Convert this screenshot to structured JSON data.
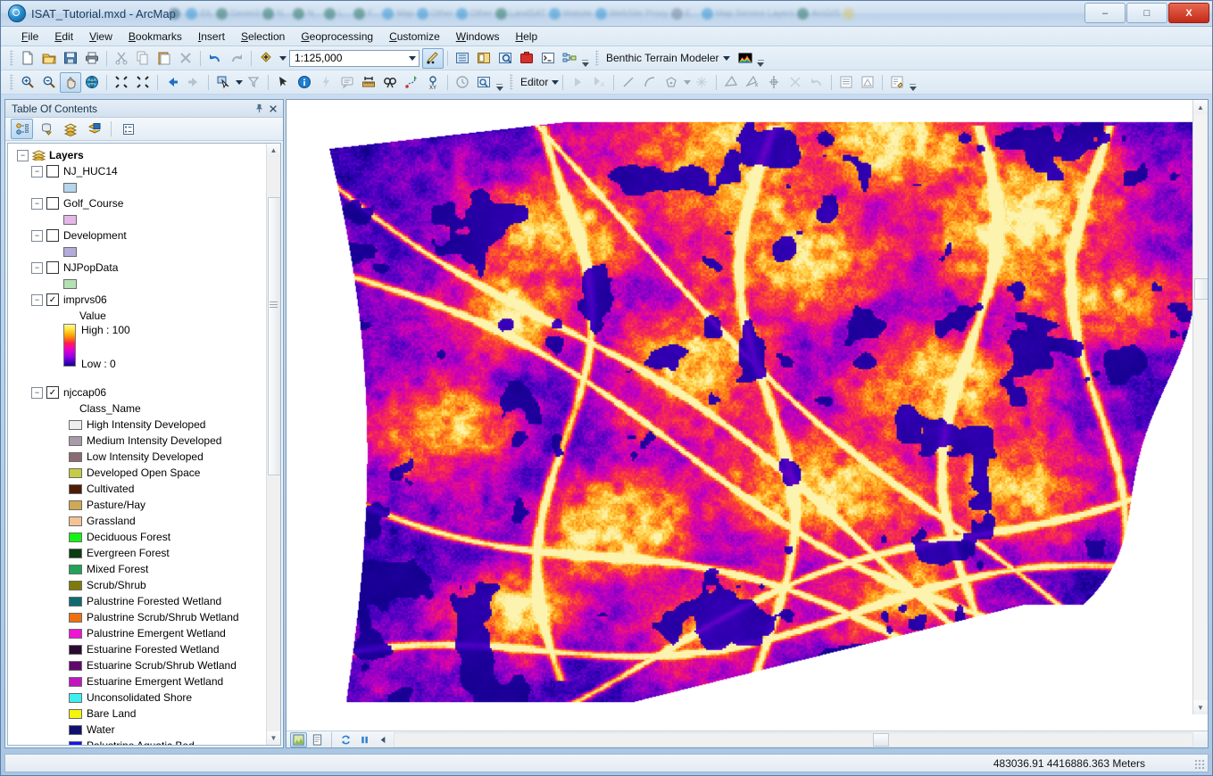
{
  "window": {
    "title": "ISAT_Tutorial.mxd - ArcMap",
    "app_icon": "arcmap-globe-icon",
    "minimize_label": "–",
    "maximize_label": "□",
    "close_label": "X",
    "background_tasks": [
      {
        "label": "",
        "color": "#2f5f7a"
      },
      {
        "label": "iDL",
        "color": "#2a8fd0"
      },
      {
        "label": "Geom3",
        "color": "#1f6b5c"
      },
      {
        "label": "N...",
        "color": "#1f6b5c"
      },
      {
        "label": "N...",
        "color": "#1f6b5c"
      },
      {
        "label": "L...",
        "color": "#1f6b5c"
      },
      {
        "label": "F...",
        "color": "#1f6b5c"
      },
      {
        "label": "Map",
        "color": "#2a8fd0"
      },
      {
        "label": "Other",
        "color": "#2a8fd0"
      },
      {
        "label": "Other",
        "color": "#2a8fd0"
      },
      {
        "label": "LandSAT",
        "color": "#1f6b5c"
      },
      {
        "label": "Watsite",
        "color": "#2a8fd0"
      },
      {
        "label": "WebSite Proxy",
        "color": "#2a8fd0"
      },
      {
        "label": "E...",
        "color": "#6d7f90"
      },
      {
        "label": "Map Service Layers",
        "color": "#2a8fd0"
      },
      {
        "label": "ArcGIS",
        "color": "#1f6b5c"
      },
      {
        "label": "",
        "color": "#d8c46a"
      }
    ]
  },
  "menu": {
    "items": [
      {
        "label": "File",
        "accel": "F"
      },
      {
        "label": "Edit",
        "accel": "E"
      },
      {
        "label": "View",
        "accel": "V"
      },
      {
        "label": "Bookmarks",
        "accel": "B"
      },
      {
        "label": "Insert",
        "accel": "I"
      },
      {
        "label": "Selection",
        "accel": "S"
      },
      {
        "label": "Geoprocessing",
        "accel": "G"
      },
      {
        "label": "Customize",
        "accel": "C"
      },
      {
        "label": "Windows",
        "accel": "W"
      },
      {
        "label": "Help",
        "accel": "H"
      }
    ]
  },
  "standard_toolbar": {
    "scale_value": "1:125,000",
    "scale_placeholder": "1:125,000",
    "extension_label": "Benthic Terrain Modeler",
    "buttons": [
      {
        "name": "new-map-icon",
        "tip": "New Map File"
      },
      {
        "name": "open-icon",
        "tip": "Open"
      },
      {
        "name": "save-icon",
        "tip": "Save"
      },
      {
        "name": "print-icon",
        "tip": "Print"
      },
      {
        "name": "cut-icon",
        "tip": "Cut"
      },
      {
        "name": "copy-icon",
        "tip": "Copy"
      },
      {
        "name": "paste-icon",
        "tip": "Paste"
      },
      {
        "name": "delete-icon",
        "tip": "Delete"
      },
      {
        "name": "undo-icon",
        "tip": "Undo"
      },
      {
        "name": "redo-icon",
        "tip": "Redo"
      },
      {
        "name": "add-data-icon",
        "tip": "Add Data"
      }
    ],
    "right_buttons": [
      {
        "name": "editor-toolbar-icon",
        "tip": "Editor Toolbar"
      },
      {
        "name": "table-of-contents-icon",
        "tip": "Table Of Contents"
      },
      {
        "name": "catalog-icon",
        "tip": "Catalog"
      },
      {
        "name": "search-icon",
        "tip": "Search"
      },
      {
        "name": "arctoolbox-icon",
        "tip": "ArcToolbox"
      },
      {
        "name": "python-window-icon",
        "tip": "Python Window"
      },
      {
        "name": "model-builder-icon",
        "tip": "ModelBuilder"
      }
    ]
  },
  "tools_toolbar": {
    "buttons": [
      {
        "name": "zoom-in-icon",
        "tip": "Zoom In"
      },
      {
        "name": "zoom-out-icon",
        "tip": "Zoom Out"
      },
      {
        "name": "pan-icon",
        "tip": "Pan",
        "active": true
      },
      {
        "name": "full-extent-icon",
        "tip": "Full Extent"
      },
      {
        "name": "fixed-zoom-in-icon",
        "tip": "Fixed Zoom In"
      },
      {
        "name": "fixed-zoom-out-icon",
        "tip": "Fixed Zoom Out"
      },
      {
        "name": "back-extent-icon",
        "tip": "Go Back To Previous Extent"
      },
      {
        "name": "forward-extent-icon",
        "tip": "Go To Next Extent"
      },
      {
        "name": "select-features-icon",
        "tip": "Select Features"
      },
      {
        "name": "clear-selection-icon",
        "tip": "Clear Selected Features"
      },
      {
        "name": "select-elements-icon",
        "tip": "Select Elements"
      },
      {
        "name": "identify-icon",
        "tip": "Identify"
      },
      {
        "name": "hyperlink-icon",
        "tip": "Hyperlink"
      },
      {
        "name": "html-popup-icon",
        "tip": "HTML Popup"
      },
      {
        "name": "measure-icon",
        "tip": "Measure"
      },
      {
        "name": "find-icon",
        "tip": "Find"
      },
      {
        "name": "find-route-icon",
        "tip": "Find Route"
      },
      {
        "name": "go-to-xy-icon",
        "tip": "Go To XY"
      },
      {
        "name": "time-slider-icon",
        "tip": "Time Slider"
      },
      {
        "name": "create-viewer-window-icon",
        "tip": "Create Viewer Window"
      }
    ],
    "editor_label": "Editor",
    "editor_buttons": [
      {
        "name": "edit-tool-icon",
        "tip": "Edit Tool"
      },
      {
        "name": "edit-annotation-icon",
        "tip": "Edit Annotation Tool"
      },
      {
        "name": "straight-segment-icon",
        "tip": "Straight Segment"
      },
      {
        "name": "curve-segment-icon",
        "tip": "End Point Arc Segment"
      },
      {
        "name": "construction-tool-icon",
        "tip": "Construction Tools"
      },
      {
        "name": "edit-vertices-icon",
        "tip": "Edit Vertices"
      },
      {
        "name": "reshape-feature-icon",
        "tip": "Reshape Feature Tool"
      },
      {
        "name": "cut-polygons-icon",
        "tip": "Cut Polygons Tool"
      },
      {
        "name": "split-tool-icon",
        "tip": "Split Tool"
      },
      {
        "name": "rotate-tool-icon",
        "tip": "Rotate Tool"
      },
      {
        "name": "undo-edit-icon",
        "tip": "Undo Edit"
      },
      {
        "name": "attributes-icon",
        "tip": "Attributes"
      },
      {
        "name": "sketch-properties-icon",
        "tip": "Sketch Properties"
      },
      {
        "name": "create-features-icon",
        "tip": "Create Features"
      }
    ]
  },
  "toc": {
    "title": "Table Of Contents",
    "pin_icon": "pin-icon",
    "close_icon": "close-icon",
    "tools": [
      {
        "name": "list-by-drawing-order-icon",
        "label": "List By Drawing Order",
        "active": true
      },
      {
        "name": "list-by-source-icon",
        "label": "List By Source",
        "active": false
      },
      {
        "name": "list-by-visibility-icon",
        "label": "List By Visibility",
        "active": false
      },
      {
        "name": "list-by-selection-icon",
        "label": "List By Selection",
        "active": false
      },
      {
        "name": "toc-options-icon",
        "label": "Options",
        "active": false
      }
    ],
    "root": "Layers",
    "layers": [
      {
        "name": "NJ_HUC14",
        "checked": false,
        "swatch": "#b5d5ea"
      },
      {
        "name": "Golf_Course",
        "checked": false,
        "swatch": "#e3b8e8"
      },
      {
        "name": "Development",
        "checked": false,
        "swatch": "#b3abd9"
      },
      {
        "name": "NJPopData",
        "checked": false,
        "swatch": "#b4e0b4"
      }
    ],
    "raster_layer": {
      "name": "imprvs06",
      "checked": true,
      "field_label": "Value",
      "high_label": "High : 100",
      "low_label": "Low : 0",
      "ramp_top": "#fff79a",
      "ramp_bottom": "#12008c"
    },
    "class_layer": {
      "name": "njccap06",
      "checked": true,
      "field_label": "Class_Name",
      "classes": [
        {
          "label": "High Intensity Developed",
          "color": "#eeeeec"
        },
        {
          "label": "Medium Intensity Developed",
          "color": "#a89aa8"
        },
        {
          "label": "Low Intensity Developed",
          "color": "#8b6b72"
        },
        {
          "label": "Developed Open Space",
          "color": "#c4cc46"
        },
        {
          "label": "Cultivated",
          "color": "#4c1c04"
        },
        {
          "label": "Pasture/Hay",
          "color": "#cfa953"
        },
        {
          "label": "Grassland",
          "color": "#f3c396"
        },
        {
          "label": "Deciduous Forest",
          "color": "#12f412"
        },
        {
          "label": "Evergreen Forest",
          "color": "#0b3d12"
        },
        {
          "label": "Mixed Forest",
          "color": "#21a358"
        },
        {
          "label": "Scrub/Shrub",
          "color": "#7e7a0a"
        },
        {
          "label": "Palustrine Forested Wetland",
          "color": "#0e6b72"
        },
        {
          "label": "Palustrine Scrub/Shrub Wetland",
          "color": "#ef6f10"
        },
        {
          "label": "Palustrine Emergent Wetland",
          "color": "#ef14d6"
        },
        {
          "label": "Estuarine Forested Wetland",
          "color": "#2a0a30"
        },
        {
          "label": "Estuarine Scrub/Shrub Wetland",
          "color": "#63086b"
        },
        {
          "label": "Estuarine Emergent Wetland",
          "color": "#c415c4"
        },
        {
          "label": "Unconsolidated Shore",
          "color": "#3df0f0"
        },
        {
          "label": "Bare Land",
          "color": "#f4f40c"
        },
        {
          "label": "Water",
          "color": "#101070"
        },
        {
          "label": "Palustrine Aquatic Bed",
          "color": "#1414f0"
        }
      ]
    }
  },
  "map": {
    "view_buttons": [
      {
        "name": "data-view-icon",
        "label": "Data View",
        "active": true
      },
      {
        "name": "layout-view-icon",
        "label": "Layout View",
        "active": false
      }
    ],
    "draw_controls": [
      {
        "name": "refresh-view-icon",
        "label": "Refresh View"
      },
      {
        "name": "pause-drawing-icon",
        "label": "Pause Drawing"
      },
      {
        "name": "scroll-left-icon",
        "label": "Scroll Left"
      }
    ]
  },
  "statusbar": {
    "coordinates": "483036.91  4416886.363 Meters"
  }
}
